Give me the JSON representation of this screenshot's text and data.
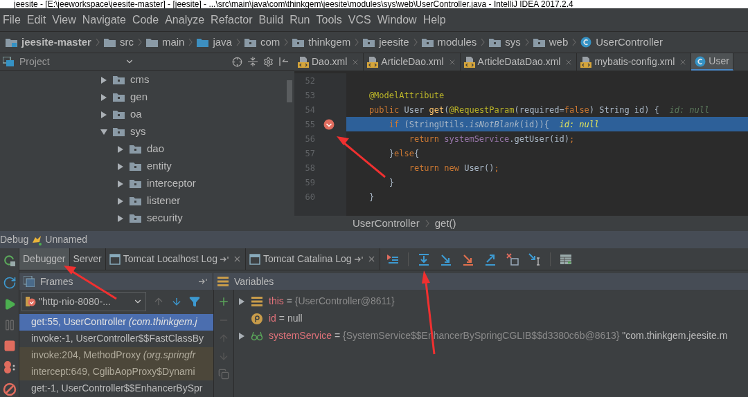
{
  "window": {
    "title": "jeesite - [E:\\jeeworkspace\\jeesite-master] - [jeesite] - ...\\src\\main\\java\\com\\thinkgem\\jeesite\\modules\\sys\\web\\UserController.java - IntelliJ IDEA 2017.2.4"
  },
  "menu": [
    "File",
    "Edit",
    "View",
    "Navigate",
    "Code",
    "Analyze",
    "Refactor",
    "Build",
    "Run",
    "Tools",
    "VCS",
    "Window",
    "Help"
  ],
  "breadcrumb": [
    {
      "label": "jeesite-master",
      "kind": "project"
    },
    {
      "label": "src",
      "kind": "folder"
    },
    {
      "label": "main",
      "kind": "folder"
    },
    {
      "label": "java",
      "kind": "source"
    },
    {
      "label": "com",
      "kind": "package"
    },
    {
      "label": "thinkgem",
      "kind": "package"
    },
    {
      "label": "jeesite",
      "kind": "package"
    },
    {
      "label": "modules",
      "kind": "package"
    },
    {
      "label": "sys",
      "kind": "package"
    },
    {
      "label": "web",
      "kind": "package"
    },
    {
      "label": "UserController",
      "kind": "class"
    }
  ],
  "project_panel": {
    "title": "Project",
    "tree": [
      {
        "label": "cms",
        "expanded": false
      },
      {
        "label": "gen",
        "expanded": false
      },
      {
        "label": "oa",
        "expanded": false
      },
      {
        "label": "sys",
        "expanded": true,
        "children": [
          {
            "label": "dao",
            "expanded": false
          },
          {
            "label": "entity",
            "expanded": false
          },
          {
            "label": "interceptor",
            "expanded": false
          },
          {
            "label": "listener",
            "expanded": false
          },
          {
            "label": "security",
            "expanded": false
          }
        ]
      }
    ]
  },
  "editor_tabs": [
    {
      "label": "Dao.xml",
      "kind": "xml",
      "selected": false
    },
    {
      "label": "ArticleDao.xml",
      "kind": "xml",
      "selected": false
    },
    {
      "label": "ArticleDataDao.xml",
      "kind": "xml",
      "selected": false
    },
    {
      "label": "mybatis-config.xml",
      "kind": "xml",
      "selected": false
    },
    {
      "label": "User",
      "kind": "class",
      "selected": true
    }
  ],
  "code": [
    {
      "number": "52",
      "breakpoint": false,
      "current": false
    },
    {
      "number": "53",
      "breakpoint": false,
      "current": false,
      "tokens": [
        {
          "kind": "annotation",
          "text": "    @ModelAttribute"
        }
      ]
    },
    {
      "number": "54",
      "breakpoint": false,
      "current": false,
      "tokens": [
        {
          "kind": "keyword",
          "text": "    public "
        },
        {
          "kind": "plain",
          "text": "User "
        },
        {
          "kind": "method",
          "text": "get"
        },
        {
          "kind": "plain",
          "text": "("
        },
        {
          "kind": "annotation",
          "text": "@RequestParam"
        },
        {
          "kind": "plain",
          "text": "(required="
        },
        {
          "kind": "keyword",
          "text": "false"
        },
        {
          "kind": "plain",
          "text": ") String id) {"
        },
        {
          "kind": "hint",
          "text": "  id: null"
        }
      ]
    },
    {
      "number": "55",
      "breakpoint": true,
      "current": true,
      "tokens": [
        {
          "kind": "keyword",
          "text": "        if "
        },
        {
          "kind": "plain",
          "text": "(StringUtils."
        },
        {
          "kind": "italic",
          "text": "isNotBlank"
        },
        {
          "kind": "plain",
          "text": "(id)){"
        },
        {
          "kind": "hint",
          "text": "  id: null"
        }
      ]
    },
    {
      "number": "56",
      "breakpoint": false,
      "current": false,
      "tokens": [
        {
          "kind": "keyword",
          "text": "            return "
        },
        {
          "kind": "field",
          "text": "systemService"
        },
        {
          "kind": "plain",
          "text": ".getUser(id)"
        },
        {
          "kind": "keyword",
          "text": ";"
        }
      ]
    },
    {
      "number": "57",
      "breakpoint": false,
      "current": false,
      "tokens": [
        {
          "kind": "plain",
          "text": "        }"
        },
        {
          "kind": "keyword",
          "text": "else"
        },
        {
          "kind": "plain",
          "text": "{"
        }
      ]
    },
    {
      "number": "58",
      "breakpoint": false,
      "current": false,
      "tokens": [
        {
          "kind": "keyword",
          "text": "            return new "
        },
        {
          "kind": "plain",
          "text": "User()"
        },
        {
          "kind": "keyword",
          "text": ";"
        }
      ]
    },
    {
      "number": "59",
      "breakpoint": false,
      "current": false,
      "tokens": [
        {
          "kind": "plain",
          "text": "        }"
        }
      ]
    },
    {
      "number": "60",
      "breakpoint": false,
      "current": false,
      "tokens": [
        {
          "kind": "plain",
          "text": "    }"
        }
      ]
    }
  ],
  "editor_breadcrumb": [
    "UserController",
    "get()"
  ],
  "debug": {
    "label": "Debug",
    "config": "Unnamed",
    "tabs": [
      {
        "label": "Debugger",
        "kind": "plain",
        "selected": true
      },
      {
        "label": "Server",
        "kind": "plain",
        "selected": false
      },
      {
        "label": "Tomcat Localhost Log",
        "kind": "log",
        "selected": false
      },
      {
        "label": "Tomcat Catalina Log",
        "kind": "log",
        "selected": false
      }
    ],
    "frames_title": "Frames",
    "variables_title": "Variables",
    "thread": "\"http-nio-8080-...",
    "frames": [
      {
        "text": "get:55, UserController",
        "package": " (com.thinkgem.j",
        "selected": true,
        "library": false
      },
      {
        "text": "invoke:-1, UserController$$FastClassBy",
        "selected": false,
        "library": false
      },
      {
        "text": "invoke:204, MethodProxy",
        "package": " (org.springfr",
        "selected": false,
        "library": true
      },
      {
        "text": "intercept:649, CglibAopProxy$Dynami",
        "selected": false,
        "library": true
      },
      {
        "text": "get:-1, UserController$$EnhancerBySpr",
        "selected": false,
        "library": false
      }
    ],
    "variables": [
      {
        "name": "this",
        "operator": "=",
        "value": "{UserController@8611}",
        "kind": "object",
        "expandable": true
      },
      {
        "name": "id",
        "operator": "=",
        "value": "null",
        "kind": "param",
        "expandable": false
      },
      {
        "name": "systemService",
        "operator": "=",
        "value": "{SystemService$$EnhancerBySpringCGLIB$$d3380c6b@8613}",
        "extra": "\"com.thinkgem.jeesite.m",
        "kind": "field",
        "expandable": true
      }
    ]
  }
}
